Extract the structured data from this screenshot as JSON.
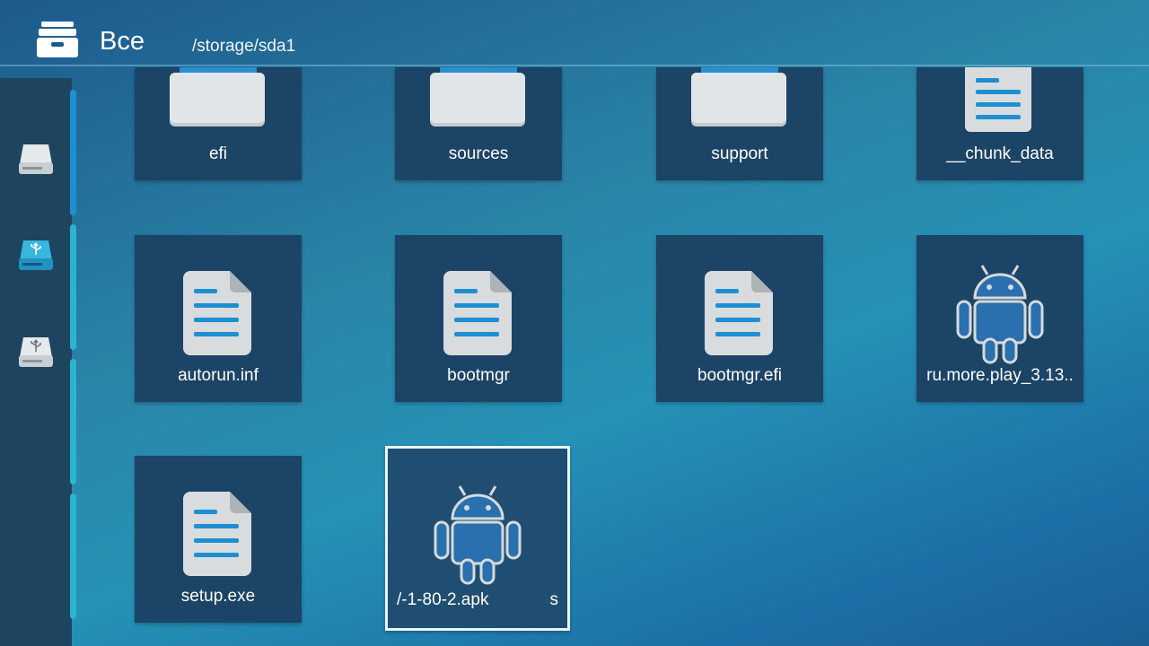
{
  "header": {
    "title": "Все",
    "path": "/storage/sda1"
  },
  "sidebar": {
    "items": [
      {
        "icon": "hard-drive-icon"
      },
      {
        "icon": "usb-drive-icon"
      },
      {
        "icon": "usb-drive-icon"
      }
    ]
  },
  "files": [
    {
      "name": "efi",
      "type": "folder"
    },
    {
      "name": "sources",
      "type": "folder"
    },
    {
      "name": "support",
      "type": "folder"
    },
    {
      "name": "__chunk_data",
      "type": "document"
    },
    {
      "name": "autorun.inf",
      "type": "document"
    },
    {
      "name": "bootmgr",
      "type": "document"
    },
    {
      "name": "bootmgr.efi",
      "type": "document"
    },
    {
      "name": "ru.more.play_3.13..",
      "type": "apk"
    },
    {
      "name": "setup.exe",
      "type": "document"
    },
    {
      "name": "/-1-80-2.apk",
      "tail": "s",
      "type": "apk",
      "selected": true
    }
  ],
  "colors": {
    "tile": "#1b4466",
    "accent": "#1e8fd0",
    "selected_border": "#e8f4fa"
  }
}
